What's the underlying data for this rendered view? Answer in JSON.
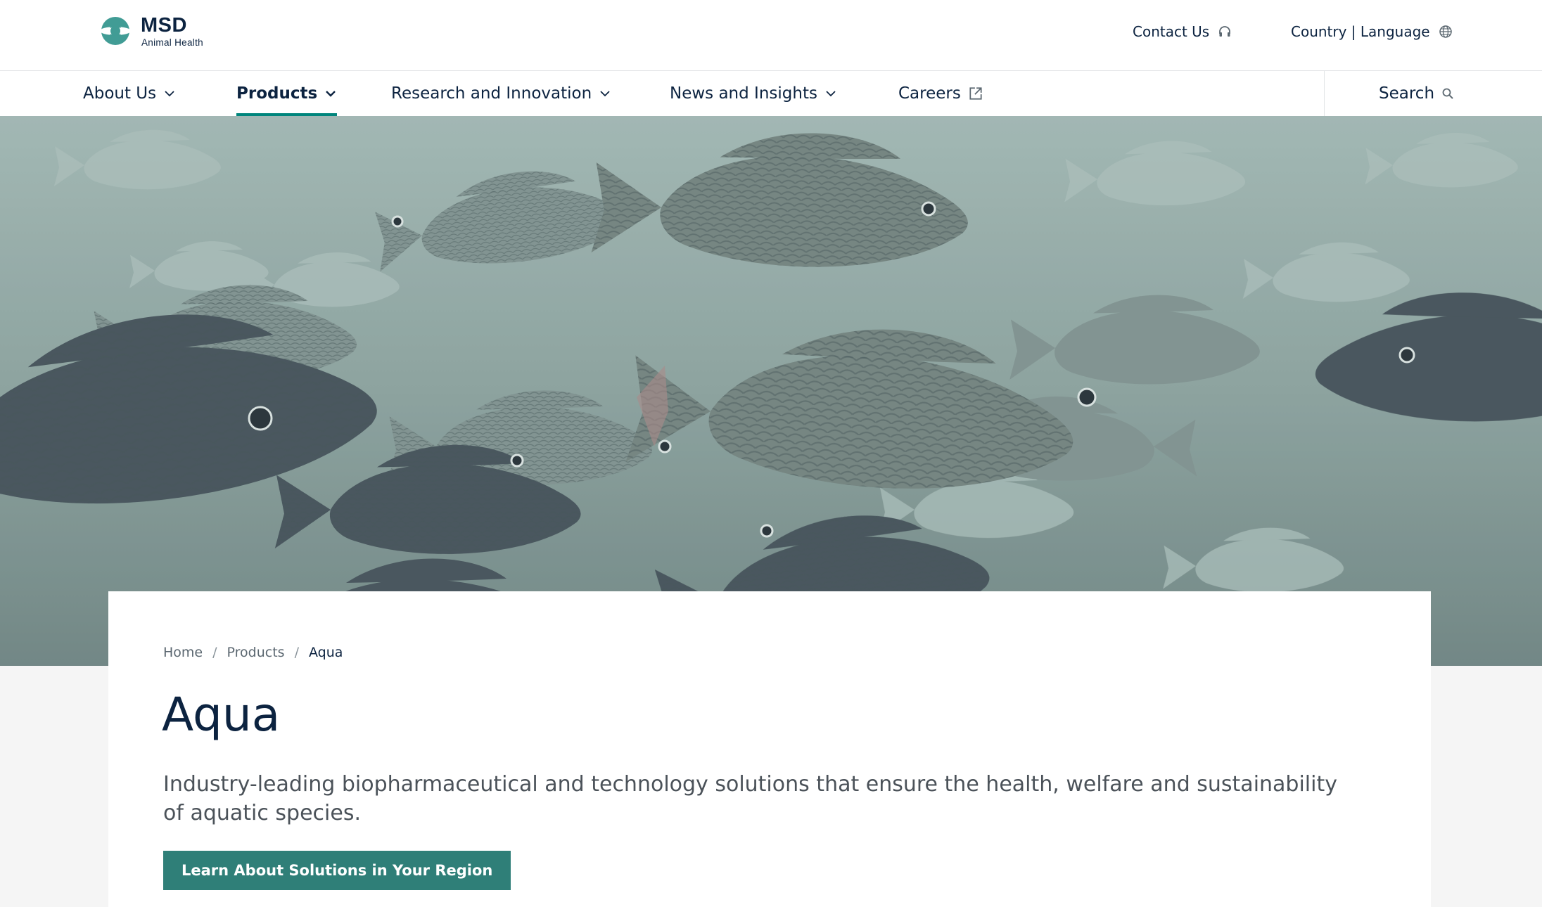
{
  "brand": {
    "name": "MSD",
    "tagline": "Animal Health",
    "colors": {
      "primary_teal": "#00857c",
      "logo_teal": "#419c95",
      "navy": "#0c2340",
      "button": "#2f7f78"
    }
  },
  "utility_nav": {
    "contact": {
      "label": "Contact Us",
      "icon": "headphones-icon"
    },
    "country_language": {
      "label": "Country | Language",
      "icon": "globe-icon"
    }
  },
  "main_nav": {
    "items": [
      {
        "label": "About Us",
        "icon": "chevron-down-icon",
        "active": false
      },
      {
        "label": "Products",
        "icon": "chevron-down-icon",
        "active": true
      },
      {
        "label": "Research and Innovation",
        "icon": "chevron-down-icon",
        "active": false
      },
      {
        "label": "News and Insights",
        "icon": "chevron-down-icon",
        "active": false
      },
      {
        "label": "Careers",
        "icon": "external-link-icon",
        "active": false
      }
    ],
    "search": {
      "label": "Search",
      "icon": "search-icon"
    }
  },
  "hero": {
    "image": "underwater school of tilapia fish"
  },
  "breadcrumb": [
    {
      "label": "Home"
    },
    {
      "label": "Products"
    },
    {
      "label": "Aqua"
    }
  ],
  "page": {
    "title": "Aqua",
    "description": "Industry-leading biopharmaceutical and technology solutions that ensure the health, welfare and sustainability of aquatic species.",
    "cta_label": "Learn About Solutions in Your Region"
  }
}
